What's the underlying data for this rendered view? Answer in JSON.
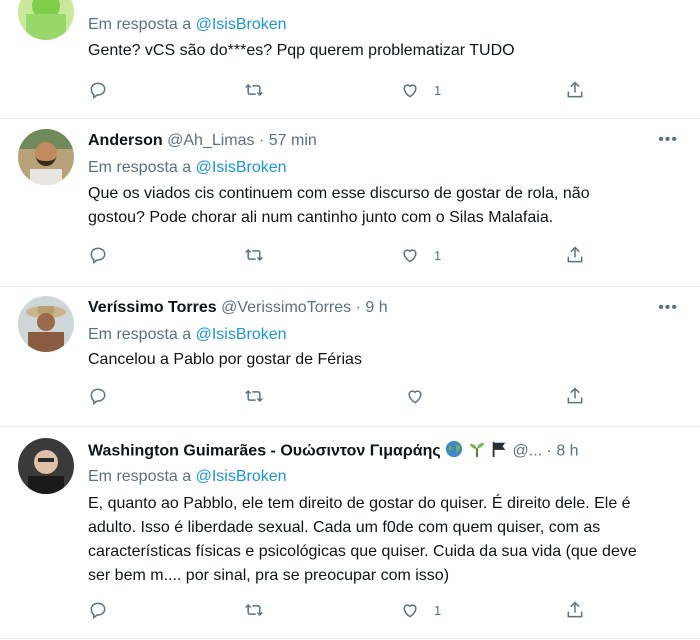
{
  "tweets": [
    {
      "replying_prefix": "Em resposta a",
      "replying_to": "@IsisBroken",
      "text_lines": [
        "Gente? vCS são do***es? Pqp querem problematizar TUDO"
      ],
      "like_count": "1"
    },
    {
      "name": "Anderson",
      "handle": "@Ah_Limas",
      "dot": "·",
      "time": "57 min",
      "replying_prefix": "Em resposta a",
      "replying_to": "@IsisBroken",
      "text_lines": [
        "Que os viados cis continuem com esse discurso de gostar de rola, não",
        "gostou? Pode chorar ali num cantinho junto com o Silas Malafaia."
      ],
      "like_count": "1"
    },
    {
      "name": "Veríssimo Torres",
      "handle": "@VerissimoTorres",
      "dot": "·",
      "time": "9 h",
      "replying_prefix": "Em resposta a",
      "replying_to": "@IsisBroken",
      "text_lines": [
        "Cancelou a Pablo por gostar de Férias"
      ],
      "like_count": ""
    },
    {
      "name": "Washington Guimarães - Ουώσιντον Γιμαράης",
      "handle": "@...",
      "dot": "·",
      "time": "8 h",
      "replying_prefix": "Em resposta a",
      "replying_to": "@IsisBroken",
      "text_lines": [
        "E, quanto ao Pabblo, ele tem direito de gostar do quiser. É direito dele. Ele é",
        "adulto. Isso é liberdade sexual. Cada um f0de com quem quiser, com as",
        "características físicas e psicológicas que quiser. Cuida da sua vida (que deve",
        "ser bem m.... por sinal, pra se preocupar com isso)"
      ],
      "like_count": "1"
    }
  ],
  "more_label": "•••",
  "icons": [
    "reply-icon",
    "retweet-icon",
    "like-icon",
    "share-icon",
    "globe-emoji",
    "seedling-emoji",
    "black-flag-emoji"
  ],
  "colors": {
    "mention": "#1b95e0",
    "muted": "#5b7083",
    "divider": "#e6ecf0"
  }
}
